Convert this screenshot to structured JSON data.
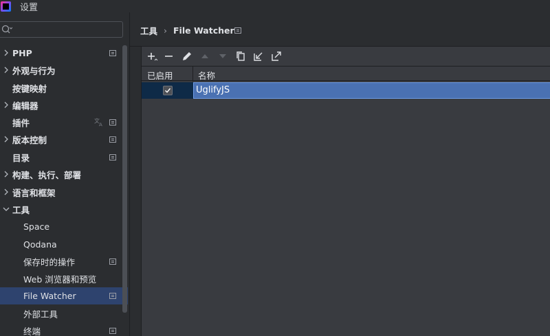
{
  "window": {
    "title": "设置"
  },
  "search": {
    "placeholder": ""
  },
  "sidebar": {
    "items": [
      {
        "label": "PHP"
      },
      {
        "label": "外观与行为"
      },
      {
        "label": "按键映射"
      },
      {
        "label": "编辑器"
      },
      {
        "label": "插件"
      },
      {
        "label": "版本控制"
      },
      {
        "label": "目录"
      },
      {
        "label": "构建、执行、部署"
      },
      {
        "label": "语言和框架"
      },
      {
        "label": "工具"
      },
      {
        "label": "Space"
      },
      {
        "label": "Qodana"
      },
      {
        "label": "保存时的操作"
      },
      {
        "label": "Web 浏览器和预览"
      },
      {
        "label": "File Watcher"
      },
      {
        "label": "外部工具"
      },
      {
        "label": "终端"
      }
    ],
    "selected": "File Watcher"
  },
  "breadcrumb": {
    "parent": "工具",
    "separator": "›",
    "current": "File Watcher"
  },
  "table": {
    "columns": [
      "已启用",
      "名称"
    ],
    "rows": [
      {
        "enabled": true,
        "name": "UglifyJS"
      }
    ]
  },
  "toolbar": {
    "icons": [
      "add-icon",
      "remove-icon",
      "edit-icon",
      "move-up-icon",
      "move-down-icon",
      "copy-icon",
      "import-icon",
      "export-icon"
    ]
  },
  "colors": {
    "selection": "#4a71b2",
    "sidebar_selected": "#2e436e",
    "background": "#2b2d30"
  }
}
